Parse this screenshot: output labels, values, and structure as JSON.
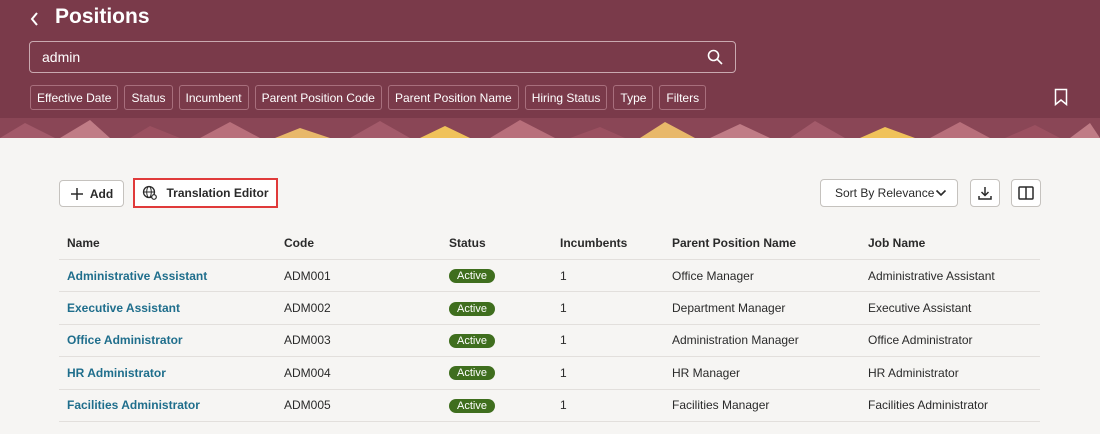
{
  "header": {
    "title": "Positions",
    "search_value": "admin",
    "filter_chips": [
      "Effective Date",
      "Status",
      "Incumbent",
      "Parent Position Code",
      "Parent Position Name",
      "Hiring Status",
      "Type",
      "Filters"
    ]
  },
  "toolbar": {
    "add_label": "Add",
    "translation_label": "Translation Editor",
    "sort_label": "Sort By Relevance"
  },
  "table": {
    "columns": [
      "Name",
      "Code",
      "Status",
      "Incumbents",
      "Parent Position Name",
      "Job Name"
    ],
    "rows": [
      {
        "name": "Administrative Assistant",
        "code": "ADM001",
        "status": "Active",
        "incumbents": "1",
        "parent": "Office Manager",
        "job": "Administrative Assistant"
      },
      {
        "name": "Executive Assistant",
        "code": "ADM002",
        "status": "Active",
        "incumbents": "1",
        "parent": "Department Manager",
        "job": "Executive Assistant"
      },
      {
        "name": "Office Administrator",
        "code": "ADM003",
        "status": "Active",
        "incumbents": "1",
        "parent": "Administration Manager",
        "job": "Office Administrator"
      },
      {
        "name": "HR Administrator",
        "code": "ADM004",
        "status": "Active",
        "incumbents": "1",
        "parent": "HR Manager",
        "job": "HR Administrator"
      },
      {
        "name": "Facilities Administrator",
        "code": "ADM005",
        "status": "Active",
        "incumbents": "1",
        "parent": "Facilities Manager",
        "job": "Facilities Administrator"
      }
    ]
  },
  "colors": {
    "header_bg": "#7a3a4a",
    "link": "#1f6e8c",
    "status_active": "#3f6e1e",
    "highlight": "#e03a3a"
  }
}
